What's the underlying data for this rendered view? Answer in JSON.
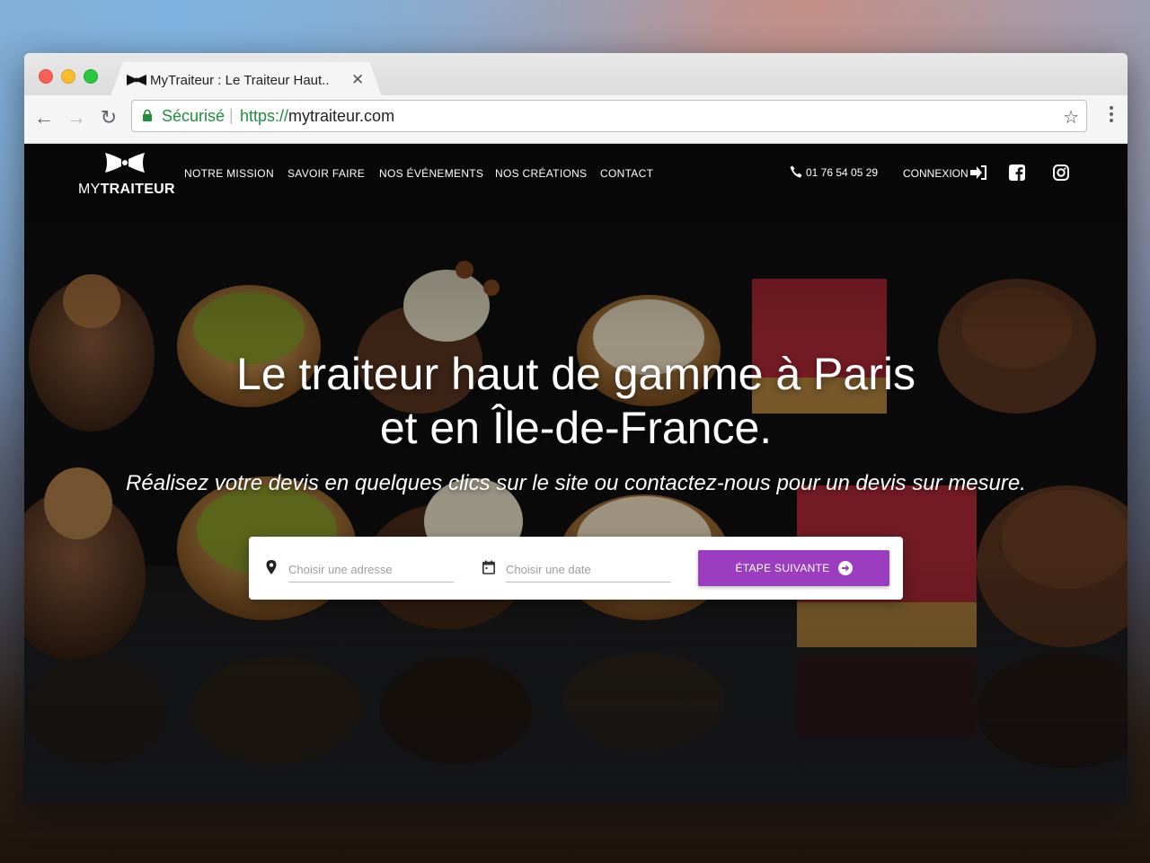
{
  "browser": {
    "tab_title": "MyTraiteur : Le Traiteur Haut..",
    "secure_label": "Sécurisé",
    "url_scheme": "https://",
    "url_host": "mytraiteur.com"
  },
  "header": {
    "logo_prefix": "MY",
    "logo_name": "TRAITEUR",
    "nav": [
      "NOTRE MISSION",
      "SAVOIR FAIRE",
      "NOS ÉVÉNEMENTS",
      "NOS CRÉATIONS",
      "CONTACT"
    ],
    "phone": "01 76 54 05 29",
    "login_label": "CONNEXION",
    "social_icons": [
      "facebook-icon",
      "instagram-icon"
    ]
  },
  "hero": {
    "title_line1": "Le traiteur haut de gamme à Paris",
    "title_line2": "et en Île-de-France.",
    "subtitle": "Réalisez votre devis en quelques clics sur le site ou contactez-nous pour un devis sur mesure."
  },
  "quote_form": {
    "address_placeholder": "Choisir une adresse",
    "date_placeholder": "Choisir une date",
    "submit_label": "ÉTAPE SUIVANTE"
  },
  "colors": {
    "accent": "#9b3dbf",
    "secure_green": "#1e8e3e"
  }
}
